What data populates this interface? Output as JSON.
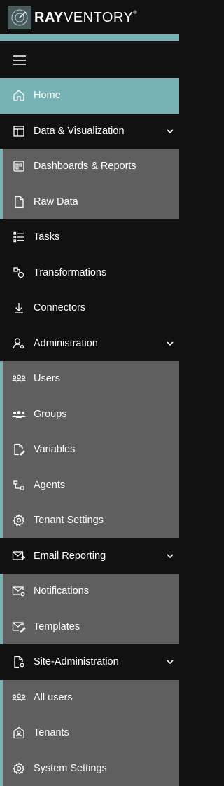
{
  "app": {
    "logo_bold": "RAY",
    "logo_thin": "VENTORY",
    "logo_mark": "®"
  },
  "colors": {
    "accent": "#77b3b5",
    "background": "#111111",
    "submenu": "#5f5f5f"
  },
  "nav": {
    "home": "Home",
    "data_visualization": "Data & Visualization",
    "dashboards_reports": "Dashboards & Reports",
    "raw_data": "Raw Data",
    "tasks": "Tasks",
    "transformations": "Transformations",
    "connectors": "Connectors",
    "administration": "Administration",
    "users": "Users",
    "groups": "Groups",
    "variables": "Variables",
    "agents": "Agents",
    "tenant_settings": "Tenant Settings",
    "email_reporting": "Email Reporting",
    "notifications": "Notifications",
    "templates": "Templates",
    "site_administration": "Site-Administration",
    "all_users": "All users",
    "tenants": "Tenants",
    "system_settings": "System Settings"
  }
}
